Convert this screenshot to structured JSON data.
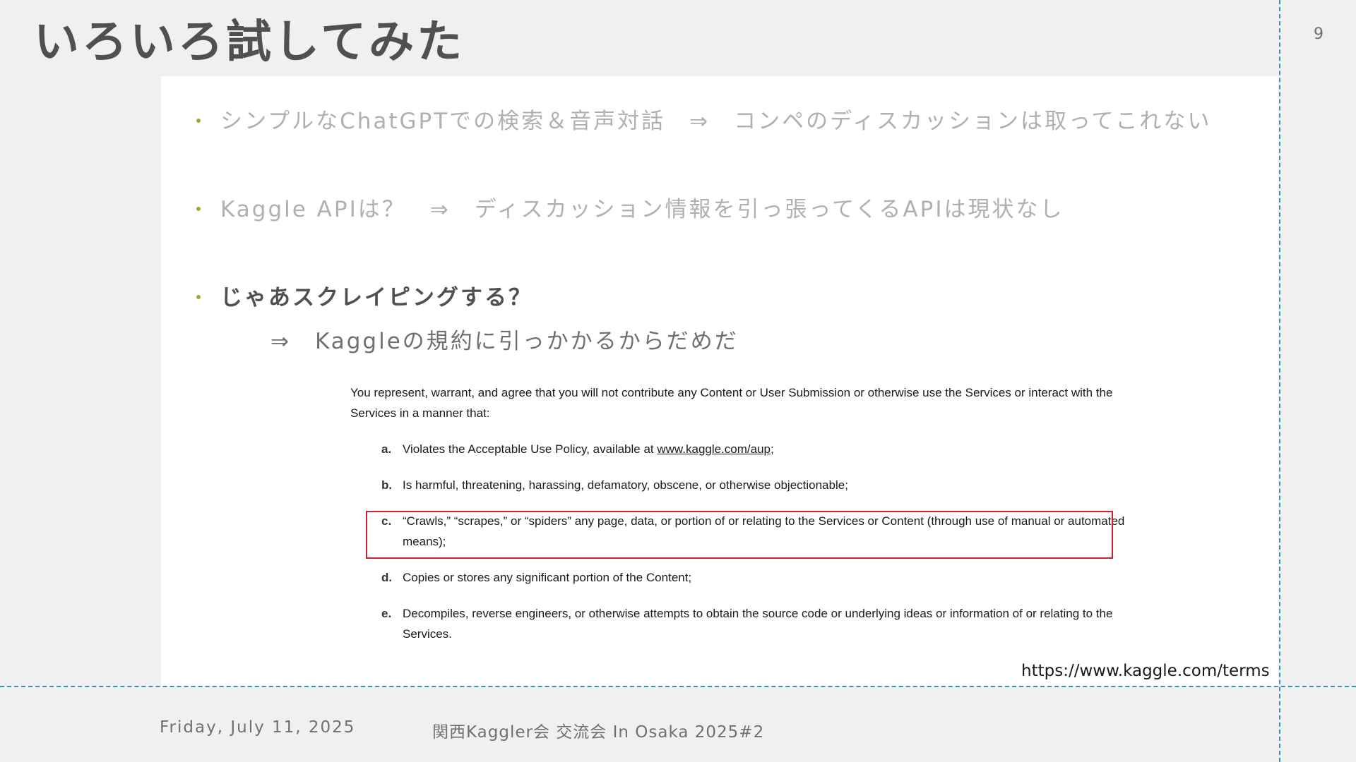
{
  "slide": {
    "title": "いろいろ試してみた",
    "page_number": "9"
  },
  "bullets": [
    {
      "text": "シンプルなChatGPTでの検索＆音声対話　⇒　コンペのディスカッションは取ってこれない"
    },
    {
      "text": "Kaggle APIは？　⇒　ディスカッション情報を引っ張ってくるAPIは現状なし"
    },
    {
      "text": "じゃあスクレイピングする？"
    }
  ],
  "sub_answer": "⇒　Kaggleの規約に引っかかるからだめだ",
  "terms": {
    "intro": "You represent, warrant, and agree that you will not contribute any Content or User Submission or otherwise use the Services or interact with the Services in a manner that:",
    "clause_a": {
      "letter": "a.",
      "text_before": "Violates the Acceptable Use Policy, available at ",
      "link": "www.kaggle.com/aup",
      "text_after": ";"
    },
    "clause_b": {
      "letter": "b.",
      "text": "Is harmful, threatening, harassing, defamatory, obscene, or otherwise objectionable;"
    },
    "clause_c": {
      "letter": "c.",
      "text": "“Crawls,” “scrapes,” or “spiders” any page, data, or portion of or relating to the Services or Content (through use of manual or automated means);"
    },
    "clause_d": {
      "letter": "d.",
      "text": "Copies or stores any significant portion of the Content;"
    },
    "clause_e": {
      "letter": "e.",
      "text": "Decompiles, reverse engineers, or otherwise attempts to obtain the source code or underlying ideas or information of or relating to the Services."
    }
  },
  "source_url": "https://www.kaggle.com/terms",
  "footer": {
    "date": "Friday, July 11, 2025",
    "event": "関西Kaggler会 交流会 In Osaka 2025#2"
  },
  "colors": {
    "bullet_dot": "#8bb33a",
    "highlight_border": "#d0202a",
    "guide_line": "#3b8fb8"
  }
}
